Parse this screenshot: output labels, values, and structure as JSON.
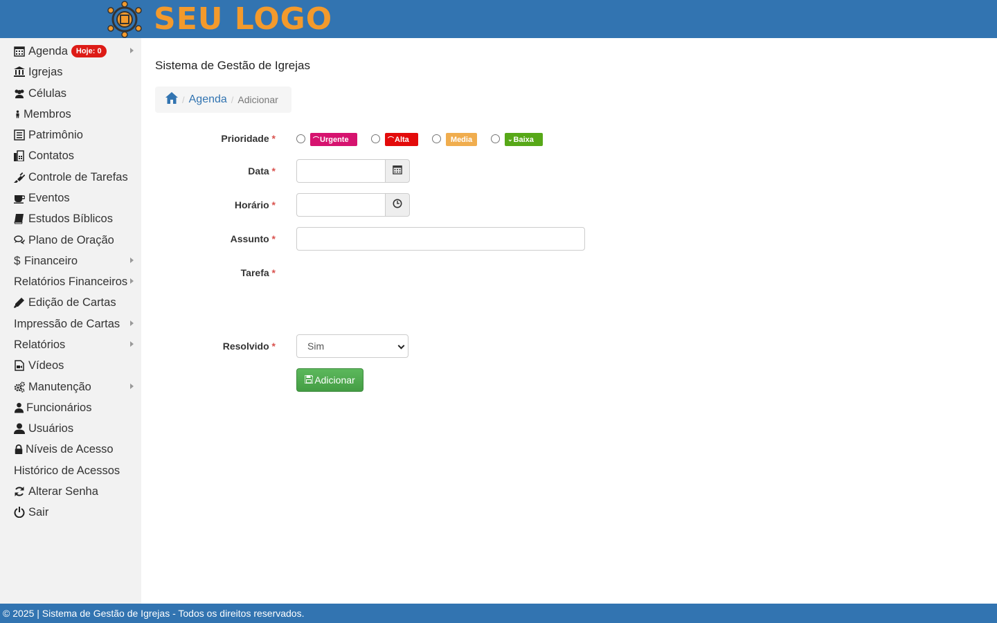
{
  "header": {
    "logo_text": "SEU LOGO"
  },
  "sidebar": {
    "items": [
      {
        "label": "Agenda",
        "icon": "calendar-icon"
      },
      {
        "label": "Igrejas",
        "icon": "bank-icon"
      },
      {
        "label": "Células",
        "icon": "users-icon"
      },
      {
        "label": "Membros",
        "icon": "male-icon"
      },
      {
        "label": "Patrimônio",
        "icon": "list-alt-icon"
      },
      {
        "label": "Contatos",
        "icon": "fax-icon"
      },
      {
        "label": "Controle de Tarefas",
        "icon": "plug-icon"
      },
      {
        "label": "Eventos",
        "icon": "coffee-icon"
      },
      {
        "label": "Estudos Bíblicos",
        "icon": "book-icon"
      },
      {
        "label": "Plano de Oração",
        "icon": "comments-icon"
      },
      {
        "label": "Financeiro",
        "icon": "dollar-icon"
      },
      {
        "label": "Relatórios Financeiros",
        "icon": ""
      },
      {
        "label": "Edição de Cartas",
        "icon": "pencil-icon"
      },
      {
        "label": "Impressão de Cartas",
        "icon": ""
      },
      {
        "label": "Relatórios",
        "icon": ""
      },
      {
        "label": "Vídeos",
        "icon": "video-file-icon"
      },
      {
        "label": "Manutenção",
        "icon": "cogs-icon"
      },
      {
        "label": "Funcionários",
        "icon": "user-icon"
      },
      {
        "label": "Usuários",
        "icon": "user-icon"
      },
      {
        "label": "Níveis de Acesso",
        "icon": "lock-icon"
      },
      {
        "label": "Histórico de Acessos",
        "icon": ""
      },
      {
        "label": "Alterar Senha",
        "icon": "refresh-icon"
      },
      {
        "label": "Sair",
        "icon": "power-icon"
      }
    ],
    "agenda_badge": "Hoje: 0"
  },
  "main": {
    "title": "Sistema de Gestão de Igrejas",
    "breadcrumb": {
      "home_icon": "home-icon",
      "link": "Agenda",
      "active": "Adicionar",
      "separator": "/"
    }
  },
  "form": {
    "required_mark": "*",
    "prioridade_label": "Prioridade",
    "priorities": [
      {
        "label": "Urgente",
        "color": "#d6136f",
        "arrow": "⌒"
      },
      {
        "label": "Alta",
        "color": "#e30b0b",
        "arrow": "⌒"
      },
      {
        "label": "Media",
        "color": "#f0ad4e",
        "arrow": ""
      },
      {
        "label": "Baixa",
        "color": "#57a818",
        "arrow": "⌄"
      }
    ],
    "data_label": "Data",
    "data_value": "",
    "horario_label": "Horário",
    "horario_value": "",
    "assunto_label": "Assunto",
    "assunto_value": "",
    "tarefa_label": "Tarefa",
    "resolvido_label": "Resolvido",
    "resolvido_value": "Sim",
    "submit_label": "Adicionar"
  },
  "footer": {
    "text": "© 2025 | Sistema de Gestão de Igrejas - Todos os direitos reservados."
  }
}
